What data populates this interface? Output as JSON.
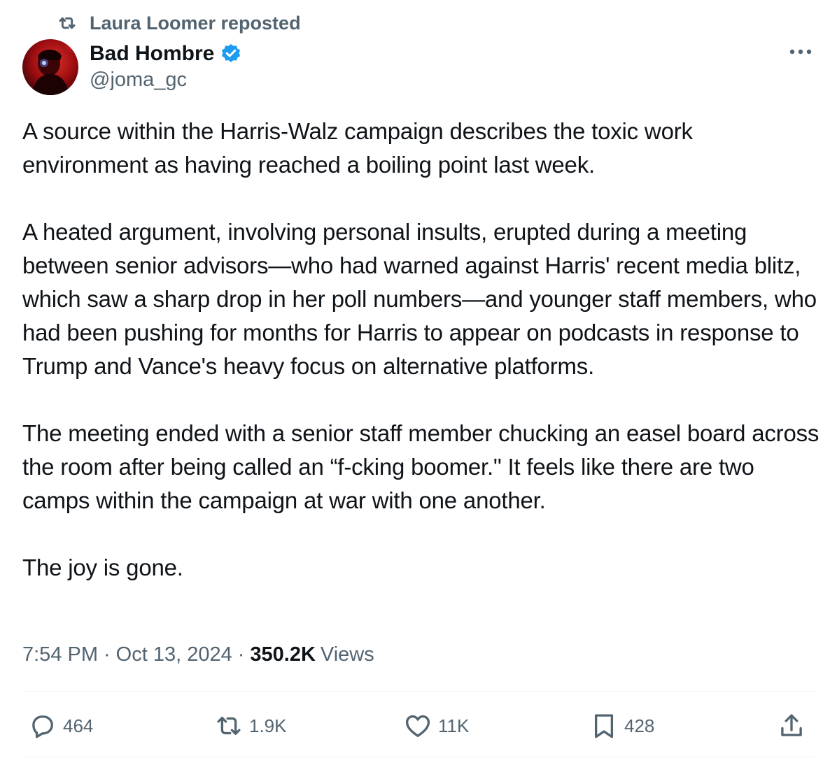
{
  "repost": {
    "text": "Laura Loomer reposted",
    "icon": "repost-icon"
  },
  "author": {
    "name": "Bad Hombre",
    "handle": "@joma_gc",
    "verified_icon": "verified-badge-icon",
    "verified_color": "#1d9bf0"
  },
  "tweet": {
    "paragraphs": [
      "A source within the Harris-Walz campaign describes the toxic work environment as having reached a boiling point last week.",
      "A heated argument, involving personal insults, erupted during a meeting between senior advisors—who had warned against Harris' recent media blitz, which saw a sharp drop in her poll numbers—and younger staff members, who had been pushing for months for Harris to appear on podcasts in response to Trump and Vance's heavy focus on alternative platforms.",
      "The meeting ended with a senior staff member chucking an easel board across the room after being called an “f-cking boomer.\" It feels like there are two camps within the campaign at war with one another.",
      "The joy is gone."
    ]
  },
  "meta": {
    "time": "7:54 PM",
    "separator": "·",
    "date": "Oct 13, 2024",
    "views_count": "350.2K",
    "views_label": "Views"
  },
  "actions": {
    "replies": {
      "count": "464",
      "icon": "reply-icon"
    },
    "reposts": {
      "count": "1.9K",
      "icon": "repost-icon"
    },
    "likes": {
      "count": "11K",
      "icon": "heart-icon"
    },
    "bookmarks": {
      "count": "428",
      "icon": "bookmark-icon"
    },
    "share": {
      "icon": "share-icon"
    }
  },
  "colors": {
    "text_primary": "#0f1419",
    "text_secondary": "#536471",
    "divider": "#eff3f4",
    "accent": "#1d9bf0"
  }
}
